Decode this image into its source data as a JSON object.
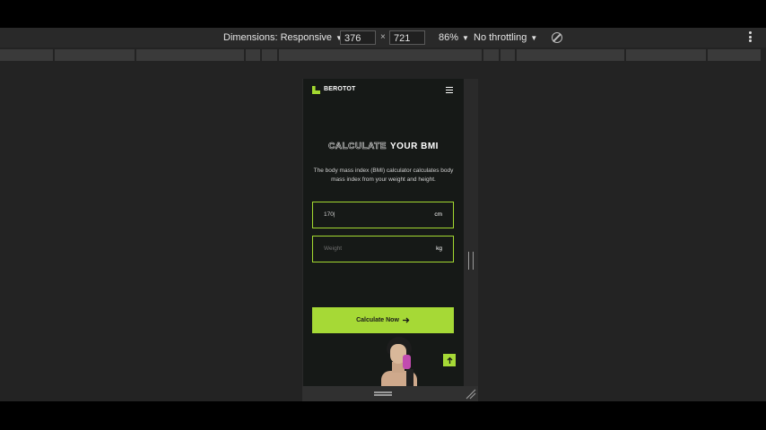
{
  "devtools": {
    "dimensions_label": "Dimensions: Responsive",
    "width_value": "376",
    "height_value": "721",
    "times_symbol": "×",
    "zoom_label": "86%",
    "throttle_label": "No throttling"
  },
  "site": {
    "brand": "BEROTOT",
    "heading_outline": "CALCULATE",
    "heading_solid": "YOUR BMI",
    "description": "The body mass index (BMI) calculator calculates body mass index from your weight and height.",
    "height_field": {
      "value": "170|",
      "unit": "cm"
    },
    "weight_field": {
      "placeholder": "Weight",
      "unit": "kg"
    },
    "calculate_button": "Calculate Now",
    "accent_color": "#a6d936"
  }
}
